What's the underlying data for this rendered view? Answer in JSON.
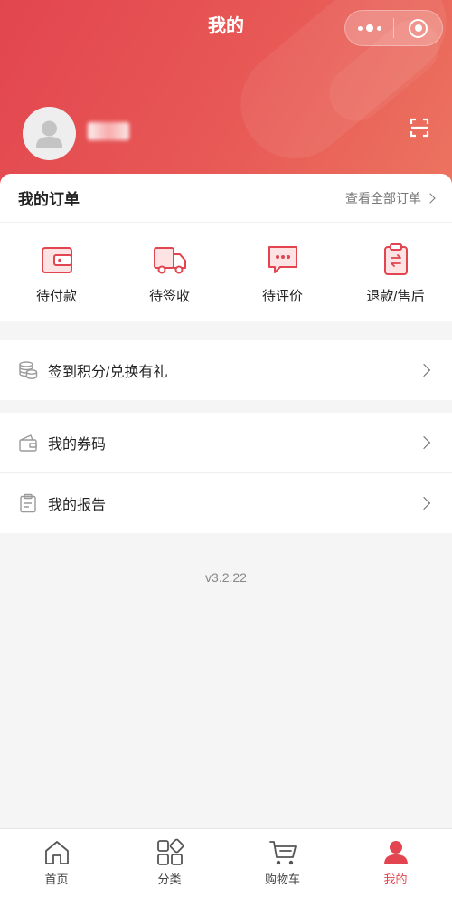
{
  "header": {
    "title": "我的",
    "username": "",
    "capsule": {
      "more_icon": "more-dots-icon",
      "close_icon": "target-icon"
    },
    "scan_icon": "scan-icon"
  },
  "orders": {
    "title": "我的订单",
    "view_all": "查看全部订单",
    "items": [
      {
        "label": "待付款",
        "icon": "wallet-icon"
      },
      {
        "label": "待签收",
        "icon": "truck-icon"
      },
      {
        "label": "待评价",
        "icon": "comment-icon"
      },
      {
        "label": "退款/售后",
        "icon": "clipboard-exchange-icon"
      }
    ]
  },
  "menu": {
    "points": {
      "label": "签到积分/兑换有礼",
      "icon": "coins-icon"
    },
    "coupons": {
      "label": "我的券码",
      "icon": "wallet-icon"
    },
    "reports": {
      "label": "我的报告",
      "icon": "clipboard-icon"
    }
  },
  "version": "v3.2.22",
  "tabbar": {
    "items": [
      {
        "label": "首页",
        "icon": "home-icon"
      },
      {
        "label": "分类",
        "icon": "category-icon"
      },
      {
        "label": "购物车",
        "icon": "cart-icon"
      },
      {
        "label": "我的",
        "icon": "user-icon"
      }
    ],
    "active_index": 3
  },
  "colors": {
    "accent": "#e2454f",
    "background": "#f5f5f5"
  }
}
